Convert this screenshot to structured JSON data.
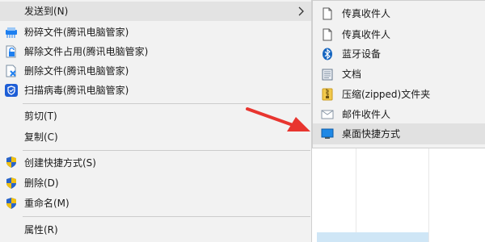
{
  "context_menu": {
    "send_to": "发送到(N)",
    "shred": "粉碎文件(腾讯电脑管家)",
    "unlock": "解除文件占用(腾讯电脑管家)",
    "delete_tencent": "删除文件(腾讯电脑管家)",
    "scan_virus": "扫描病毒(腾讯电脑管家)",
    "cut": "剪切(T)",
    "copy": "复制(C)",
    "create_shortcut": "创建快捷方式(S)",
    "delete": "删除(D)",
    "rename": "重命名(M)",
    "properties": "属性(R)"
  },
  "send_to_submenu": {
    "fax1": "传真收件人",
    "fax2": "传真收件人",
    "bluetooth": "蓝牙设备",
    "documents": "文档",
    "zip": "压缩(zipped)文件夹",
    "mail": "邮件收件人",
    "desktop_shortcut": "桌面快捷方式"
  },
  "colors": {
    "menu_bg": "#f2f2f2",
    "highlight": "#e1e1e1",
    "arrow_red": "#e8352f",
    "tencent_blue": "#1e7ff0",
    "uac_blue": "#2a64c8",
    "uac_yellow": "#f0c010"
  },
  "icons": {
    "shred": "shredder-icon",
    "unlock": "unlock-file-icon",
    "delete_tencent": "delete-file-icon",
    "scan_virus": "shield-scan-icon",
    "create_shortcut": "uac-shield-icon",
    "delete": "uac-shield-icon",
    "rename": "uac-shield-icon",
    "fax": "blank-document-icon",
    "bluetooth": "bluetooth-icon",
    "documents": "documents-icon",
    "zip": "zip-folder-icon",
    "mail": "mail-envelope-icon",
    "desktop": "desktop-icon"
  }
}
